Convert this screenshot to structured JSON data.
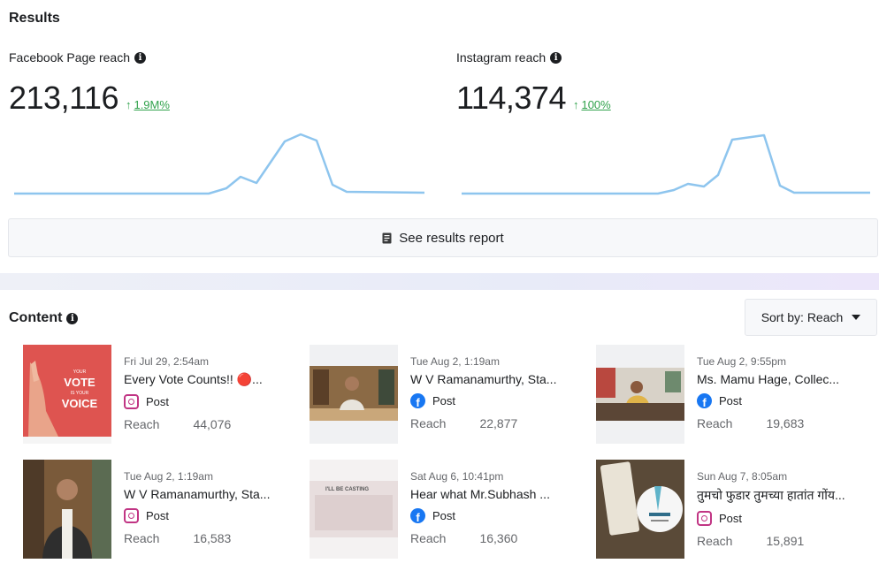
{
  "results": {
    "title": "Results",
    "facebook": {
      "label": "Facebook Page reach",
      "value": "213,116",
      "change": "1.9M%",
      "info_icon": "info-icon"
    },
    "instagram": {
      "label": "Instagram reach",
      "value": "114,374",
      "change": "100%",
      "info_icon": "info-icon"
    },
    "report_button": {
      "label": "See results report",
      "icon": "report-icon"
    }
  },
  "content": {
    "title": "Content",
    "sort_label": "Sort by: Reach",
    "reach_label": "Reach",
    "post_label": "Post",
    "posts": [
      {
        "date": "Fri Jul 29, 2:54am",
        "title": "Every Vote Counts!! 🔴...",
        "platform": "instagram",
        "reach": "44,076",
        "thumb_text_1": "YOUR",
        "thumb_text_2": "VOTE",
        "thumb_text_3": "IS YOUR",
        "thumb_text_4": "VOICE"
      },
      {
        "date": "Tue Aug 2, 1:19am",
        "title": "W V Ramanamurthy, Sta...",
        "platform": "facebook",
        "reach": "22,877"
      },
      {
        "date": "Tue Aug 2, 9:55pm",
        "title": "Ms. Mamu Hage, Collec...",
        "platform": "facebook",
        "reach": "19,683"
      },
      {
        "date": "Tue Aug 2, 1:19am",
        "title": "W V Ramanamurthy, Sta...",
        "platform": "instagram",
        "reach": "16,583"
      },
      {
        "date": "Sat Aug 6, 10:41pm",
        "title": "Hear what Mr.Subhash ...",
        "platform": "facebook",
        "reach": "16,360",
        "thumb_text_1": "I'LL BE CASTING"
      },
      {
        "date": "Sun Aug 7, 8:05am",
        "title": "तुमचो फुडार तुमच्या हातांत गोंय...",
        "platform": "instagram",
        "reach": "15,891"
      }
    ]
  },
  "colors": {
    "accent_green": "#31a24c",
    "sparkline": "#8ec5ee",
    "facebook_blue": "#1877f2",
    "instagram_pink": "#c13584"
  }
}
